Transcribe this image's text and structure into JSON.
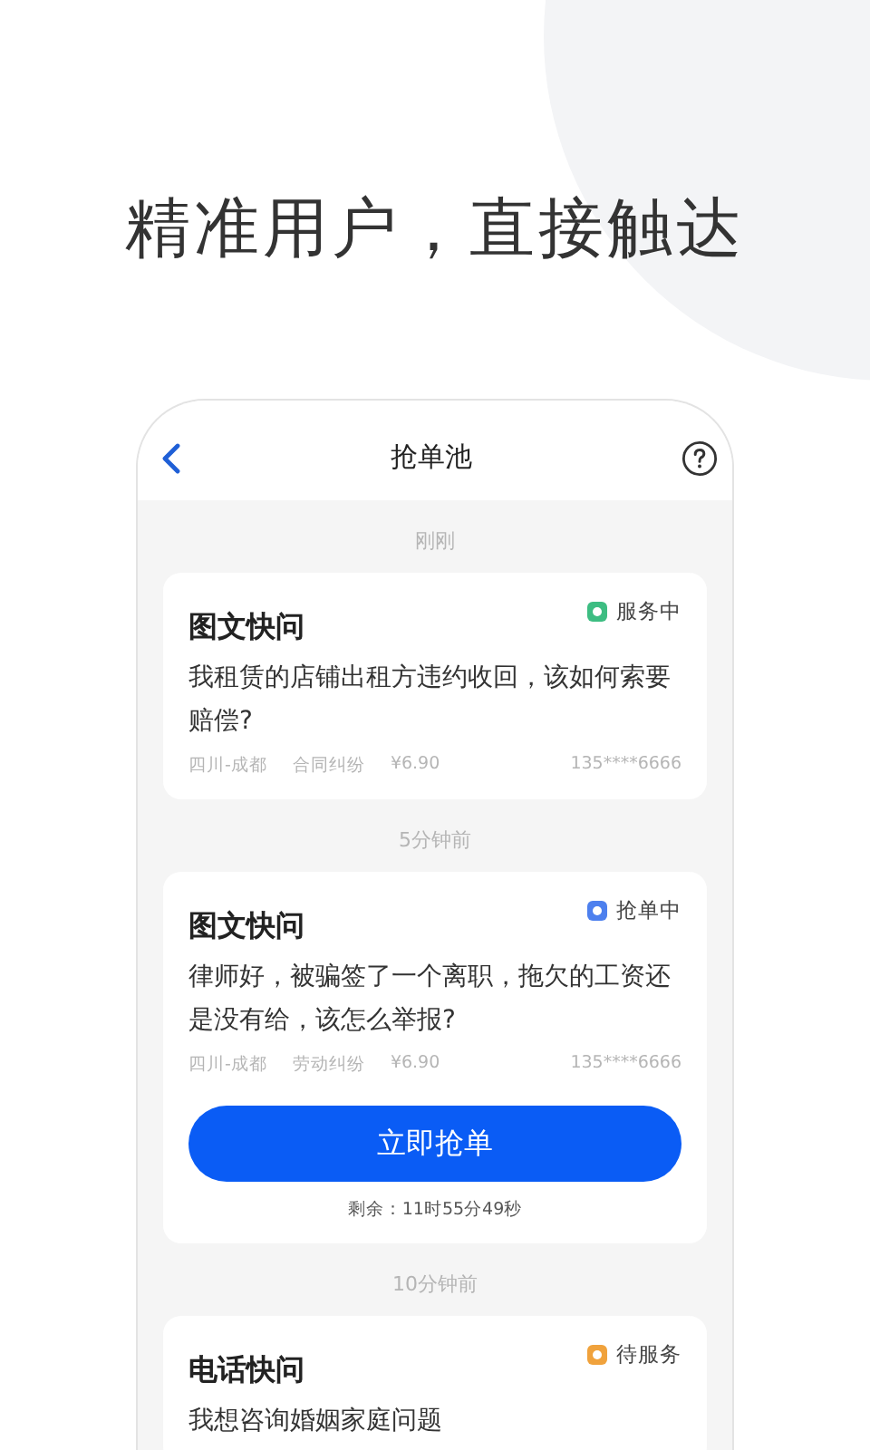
{
  "headline": "精准用户，直接触达",
  "screen": {
    "title": "抢单池",
    "groups": [
      {
        "time": "刚刚",
        "orders": [
          {
            "type": "图文快问",
            "status": "服务中",
            "color": "#3dbd82",
            "question": "我租赁的店铺出租方违约收回，该如何索要赔偿?",
            "region": "四川-成都",
            "category": "合同纠纷",
            "price": "¥6.90",
            "phone": "135****6666"
          }
        ]
      },
      {
        "time": "5分钟前",
        "orders": [
          {
            "type": "图文快问",
            "status": "抢单中",
            "color": "#4d80ee",
            "question": "律师好，被骗签了一个离职，拖欠的工资还是没有给，该怎么举报?",
            "region": "四川-成都",
            "category": "劳动纠纷",
            "price": "¥6.90",
            "phone": "135****6666",
            "action": "立即抢单",
            "remaining": "剩余：11时55分49秒"
          }
        ]
      },
      {
        "time": "10分钟前",
        "orders": [
          {
            "type": "电话快问",
            "status": "待服务",
            "color": "#f0a23c",
            "question": "我想咨询婚姻家庭问题"
          }
        ]
      }
    ]
  }
}
